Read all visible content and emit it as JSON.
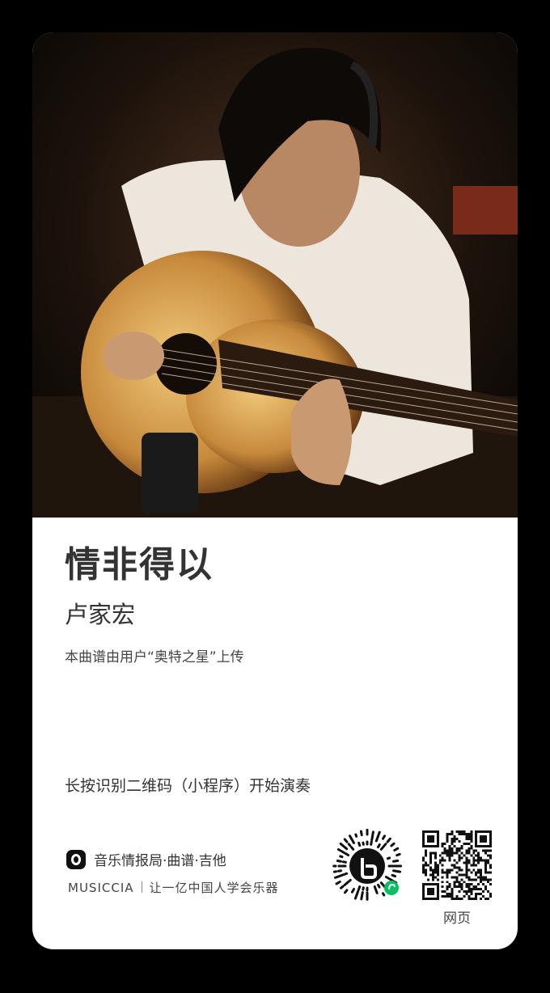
{
  "song": {
    "title": "情非得以",
    "artist": "卢家宏",
    "uploader_note": "本曲谱由用户“奥特之星”上传"
  },
  "footer": {
    "hint": "长按识别二维码（小程序）开始演奏",
    "brand_name": "音乐情报局·曲谱·吉他",
    "brand_en": "MUSICCIA",
    "slogan": "让一亿中国人学会乐器",
    "qr_label": "网页"
  },
  "icons": {
    "brand": "brand-logo-icon",
    "mini_program": "mini-program-code-icon",
    "qr": "qr-code-icon",
    "wechat_badge": "wechat-mini-program-icon"
  },
  "colors": {
    "background": "#000000",
    "card": "#ffffff",
    "text": "#333333",
    "wechat_green": "#07c160"
  }
}
